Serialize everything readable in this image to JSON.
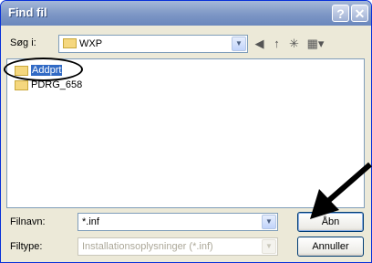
{
  "window": {
    "title": "Find fil",
    "help": "?",
    "close": "✕"
  },
  "lookin": {
    "label": "Søg i:",
    "value": "WXP"
  },
  "toolbar": {
    "back": "◀",
    "up": "↑",
    "newfolder": "✳",
    "view": "▦▾"
  },
  "files": [
    {
      "name": "Addprt",
      "selected": true
    },
    {
      "name": "PDRG_658",
      "selected": false
    }
  ],
  "filename": {
    "label": "Filnavn:",
    "value": "*.inf"
  },
  "filetype": {
    "label": "Filtype:",
    "value": "Installationsoplysninger (*.inf)"
  },
  "buttons": {
    "open": "Åbn",
    "cancel": "Annuller"
  },
  "colors": {
    "title_gradient_top": "#a5b8d9",
    "selection": "#316ac5"
  }
}
